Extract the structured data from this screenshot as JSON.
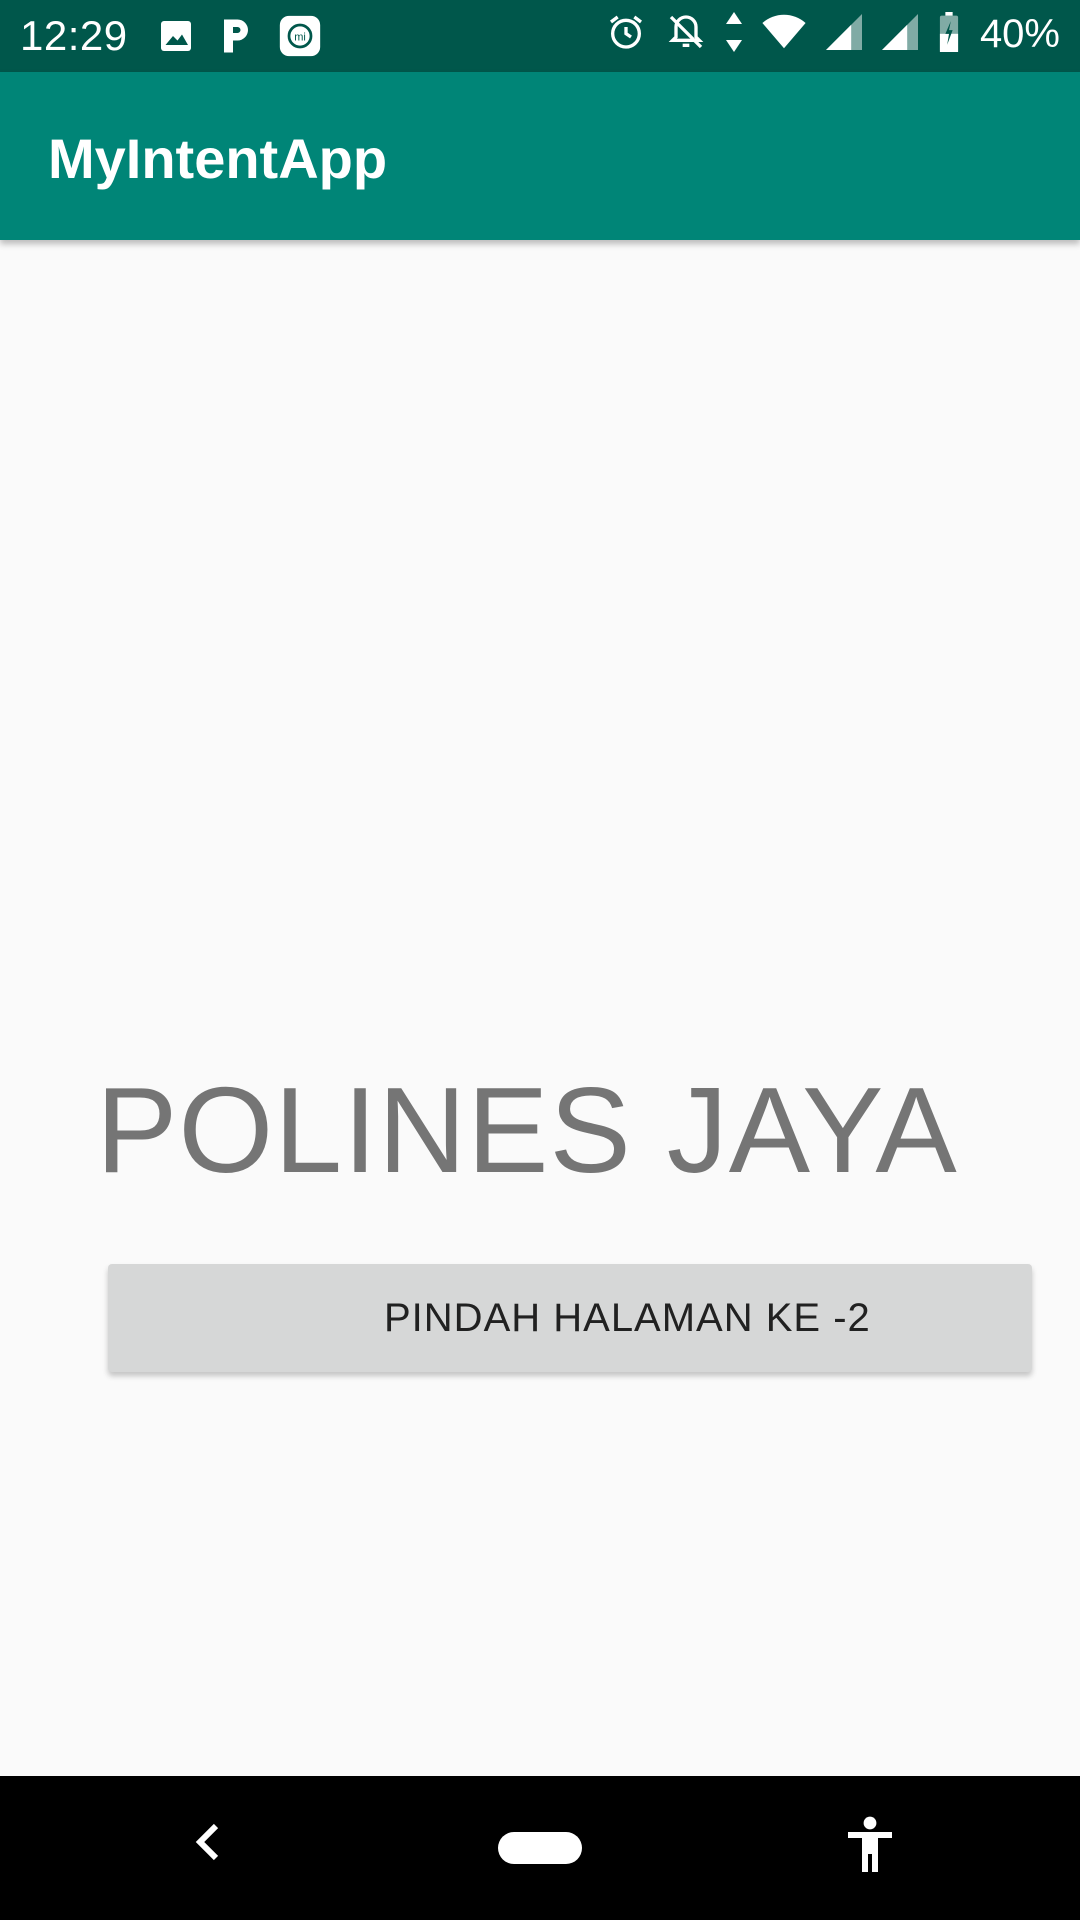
{
  "status_bar": {
    "time": "12:29",
    "battery": "40%",
    "left_icons": [
      "gallery-icon",
      "parking-app-icon",
      "mi-app-icon"
    ],
    "right_icons": [
      "alarm-icon",
      "notifications-off-icon",
      "data-arrows-icon",
      "wifi-icon",
      "signal-icon",
      "signal-icon",
      "battery-charging-icon"
    ]
  },
  "app_bar": {
    "title": "MyIntentApp",
    "color": "#008577",
    "status_color": "#00574b"
  },
  "main": {
    "heading": "POLINES JAYA",
    "button_label": "PINDAH HALAMAN KE -2"
  },
  "nav_bar": {
    "icons": [
      "back-icon",
      "home-pill-icon",
      "accessibility-icon"
    ]
  }
}
